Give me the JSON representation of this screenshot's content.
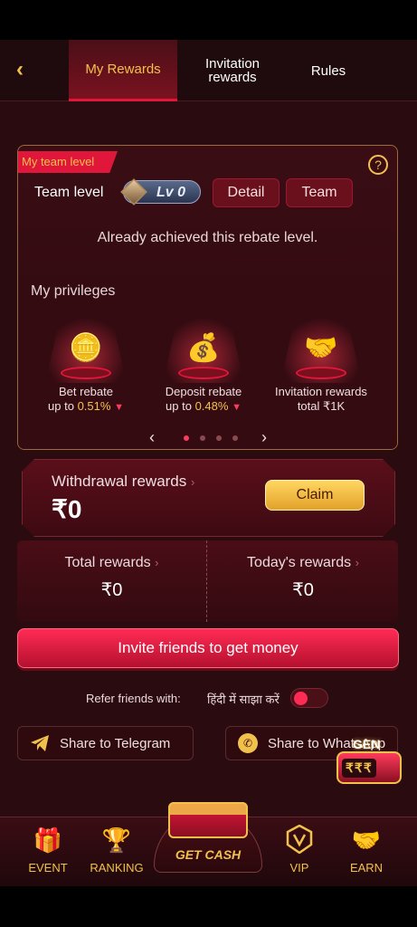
{
  "header": {
    "back_icon": "back-arrow-icon",
    "tabs": [
      {
        "label": "My Rewards",
        "active": true
      },
      {
        "label": "Invitation rewards",
        "active": false
      },
      {
        "label": "Rules",
        "active": false
      }
    ]
  },
  "team": {
    "ribbon": "My team level",
    "label": "Team level",
    "level": "Lv 0",
    "detail_label": "Detail",
    "team_label": "Team",
    "achieved_text": "Already achieved this rebate level.",
    "privileges_title": "My privileges",
    "privileges": [
      {
        "line1": "Bet rebate",
        "line2_prefix": "up to ",
        "value": "0.51%",
        "icon": "coins-gems-icon"
      },
      {
        "line1": "Deposit rebate",
        "line2_prefix": "up to ",
        "value": "0.48%",
        "icon": "money-chest-icon"
      },
      {
        "line1": "Invitation rewards",
        "line2_prefix": "total ",
        "value": "₹1K",
        "icon": "handshake-icon"
      }
    ],
    "pager_active_index": 0,
    "pager_count": 4
  },
  "withdrawal": {
    "title": "Withdrawal rewards",
    "amount": "₹0",
    "claim_label": "Claim"
  },
  "stats": {
    "total_label": "Total rewards",
    "total_value": "₹0",
    "today_label": "Today's rewards",
    "today_value": "₹0"
  },
  "invite_label": "Invite friends to get money",
  "refer": {
    "label": "Refer friends with:",
    "language": "हिंदी में साझा करें",
    "toggle_on": false
  },
  "share": {
    "telegram_label": "Share to Telegram",
    "whatsapp_label": "Share to WhatsApp"
  },
  "slot": {
    "label": "GEN",
    "reels": "₹₹₹"
  },
  "nav": {
    "event": "EVENT",
    "ranking": "RANKING",
    "getcash": "GET CASH",
    "vip": "VIP",
    "earn": "EARN"
  },
  "colors": {
    "accent": "#e0163a",
    "gold": "#f2c14b",
    "background": "#2a0b10"
  }
}
